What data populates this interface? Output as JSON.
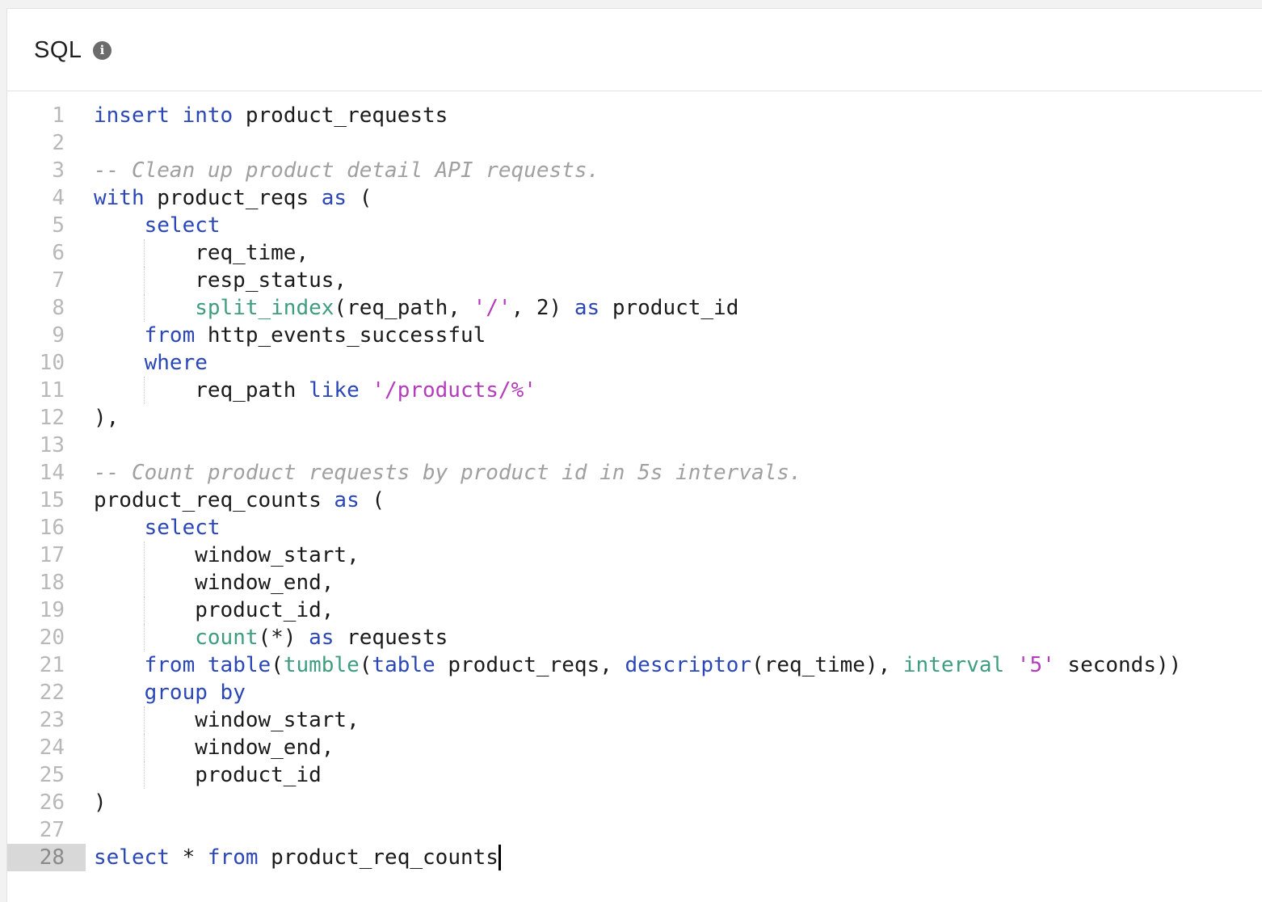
{
  "header": {
    "title": "SQL",
    "info_icon": "info-icon",
    "info_glyph": "i"
  },
  "colors": {
    "keyword": "#2a46b8",
    "function": "#3e9d7e",
    "string": "#b53bbd",
    "comment": "#a0a0a0",
    "text": "#1a1a1a",
    "line_number": "#b8b8b8",
    "active_line_gutter": "#d8d8d8"
  },
  "editor": {
    "active_line": 28,
    "lines": [
      {
        "n": "1",
        "guide": false,
        "tokens": [
          {
            "t": "kw",
            "v": "insert"
          },
          {
            "t": "plain",
            "v": " "
          },
          {
            "t": "kw",
            "v": "into"
          },
          {
            "t": "plain",
            "v": " product_requests"
          }
        ]
      },
      {
        "n": "2",
        "guide": false,
        "tokens": []
      },
      {
        "n": "3",
        "guide": false,
        "tokens": [
          {
            "t": "cmt",
            "v": "-- Clean up product detail API requests."
          }
        ]
      },
      {
        "n": "4",
        "guide": false,
        "tokens": [
          {
            "t": "kw",
            "v": "with"
          },
          {
            "t": "plain",
            "v": " product_reqs "
          },
          {
            "t": "kw",
            "v": "as"
          },
          {
            "t": "plain",
            "v": " ("
          }
        ]
      },
      {
        "n": "5",
        "guide": false,
        "tokens": [
          {
            "t": "plain",
            "v": "    "
          },
          {
            "t": "kw",
            "v": "select"
          }
        ]
      },
      {
        "n": "6",
        "guide": true,
        "tokens": [
          {
            "t": "plain",
            "v": "        req_time,"
          }
        ]
      },
      {
        "n": "7",
        "guide": true,
        "tokens": [
          {
            "t": "plain",
            "v": "        resp_status,"
          }
        ]
      },
      {
        "n": "8",
        "guide": true,
        "tokens": [
          {
            "t": "plain",
            "v": "        "
          },
          {
            "t": "fn",
            "v": "split_index"
          },
          {
            "t": "plain",
            "v": "(req_path, "
          },
          {
            "t": "str",
            "v": "'/'"
          },
          {
            "t": "plain",
            "v": ", 2) "
          },
          {
            "t": "kw",
            "v": "as"
          },
          {
            "t": "plain",
            "v": " product_id"
          }
        ]
      },
      {
        "n": "9",
        "guide": false,
        "tokens": [
          {
            "t": "plain",
            "v": "    "
          },
          {
            "t": "kw",
            "v": "from"
          },
          {
            "t": "plain",
            "v": " http_events_successful"
          }
        ]
      },
      {
        "n": "10",
        "guide": false,
        "tokens": [
          {
            "t": "plain",
            "v": "    "
          },
          {
            "t": "kw",
            "v": "where"
          }
        ]
      },
      {
        "n": "11",
        "guide": true,
        "tokens": [
          {
            "t": "plain",
            "v": "        req_path "
          },
          {
            "t": "kw",
            "v": "like"
          },
          {
            "t": "plain",
            "v": " "
          },
          {
            "t": "str",
            "v": "'/products/%'"
          }
        ]
      },
      {
        "n": "12",
        "guide": false,
        "tokens": [
          {
            "t": "plain",
            "v": "),"
          }
        ]
      },
      {
        "n": "13",
        "guide": false,
        "tokens": []
      },
      {
        "n": "14",
        "guide": false,
        "tokens": [
          {
            "t": "cmt",
            "v": "-- Count product requests by product id in 5s intervals."
          }
        ]
      },
      {
        "n": "15",
        "guide": false,
        "tokens": [
          {
            "t": "plain",
            "v": "product_req_counts "
          },
          {
            "t": "kw",
            "v": "as"
          },
          {
            "t": "plain",
            "v": " ("
          }
        ]
      },
      {
        "n": "16",
        "guide": false,
        "tokens": [
          {
            "t": "plain",
            "v": "    "
          },
          {
            "t": "kw",
            "v": "select"
          }
        ]
      },
      {
        "n": "17",
        "guide": true,
        "tokens": [
          {
            "t": "plain",
            "v": "        window_start,"
          }
        ]
      },
      {
        "n": "18",
        "guide": true,
        "tokens": [
          {
            "t": "plain",
            "v": "        window_end,"
          }
        ]
      },
      {
        "n": "19",
        "guide": true,
        "tokens": [
          {
            "t": "plain",
            "v": "        product_id,"
          }
        ]
      },
      {
        "n": "20",
        "guide": true,
        "tokens": [
          {
            "t": "plain",
            "v": "        "
          },
          {
            "t": "fn",
            "v": "count"
          },
          {
            "t": "plain",
            "v": "(*) "
          },
          {
            "t": "kw",
            "v": "as"
          },
          {
            "t": "plain",
            "v": " requests"
          }
        ]
      },
      {
        "n": "21",
        "guide": false,
        "tokens": [
          {
            "t": "plain",
            "v": "    "
          },
          {
            "t": "kw",
            "v": "from"
          },
          {
            "t": "plain",
            "v": " "
          },
          {
            "t": "kw",
            "v": "table"
          },
          {
            "t": "plain",
            "v": "("
          },
          {
            "t": "fn",
            "v": "tumble"
          },
          {
            "t": "plain",
            "v": "("
          },
          {
            "t": "kw",
            "v": "table"
          },
          {
            "t": "plain",
            "v": " product_reqs, "
          },
          {
            "t": "kw",
            "v": "descriptor"
          },
          {
            "t": "plain",
            "v": "(req_time), "
          },
          {
            "t": "fn",
            "v": "interval"
          },
          {
            "t": "plain",
            "v": " "
          },
          {
            "t": "str",
            "v": "'5'"
          },
          {
            "t": "plain",
            "v": " seconds))"
          }
        ]
      },
      {
        "n": "22",
        "guide": false,
        "tokens": [
          {
            "t": "plain",
            "v": "    "
          },
          {
            "t": "kw",
            "v": "group by"
          }
        ]
      },
      {
        "n": "23",
        "guide": true,
        "tokens": [
          {
            "t": "plain",
            "v": "        window_start,"
          }
        ]
      },
      {
        "n": "24",
        "guide": true,
        "tokens": [
          {
            "t": "plain",
            "v": "        window_end,"
          }
        ]
      },
      {
        "n": "25",
        "guide": true,
        "tokens": [
          {
            "t": "plain",
            "v": "        product_id"
          }
        ]
      },
      {
        "n": "26",
        "guide": false,
        "tokens": [
          {
            "t": "plain",
            "v": ")"
          }
        ]
      },
      {
        "n": "27",
        "guide": false,
        "tokens": []
      },
      {
        "n": "28",
        "guide": false,
        "tokens": [
          {
            "t": "kw",
            "v": "select"
          },
          {
            "t": "plain",
            "v": " * "
          },
          {
            "t": "kw",
            "v": "from"
          },
          {
            "t": "plain",
            "v": " product_req_counts"
          }
        ]
      }
    ]
  }
}
